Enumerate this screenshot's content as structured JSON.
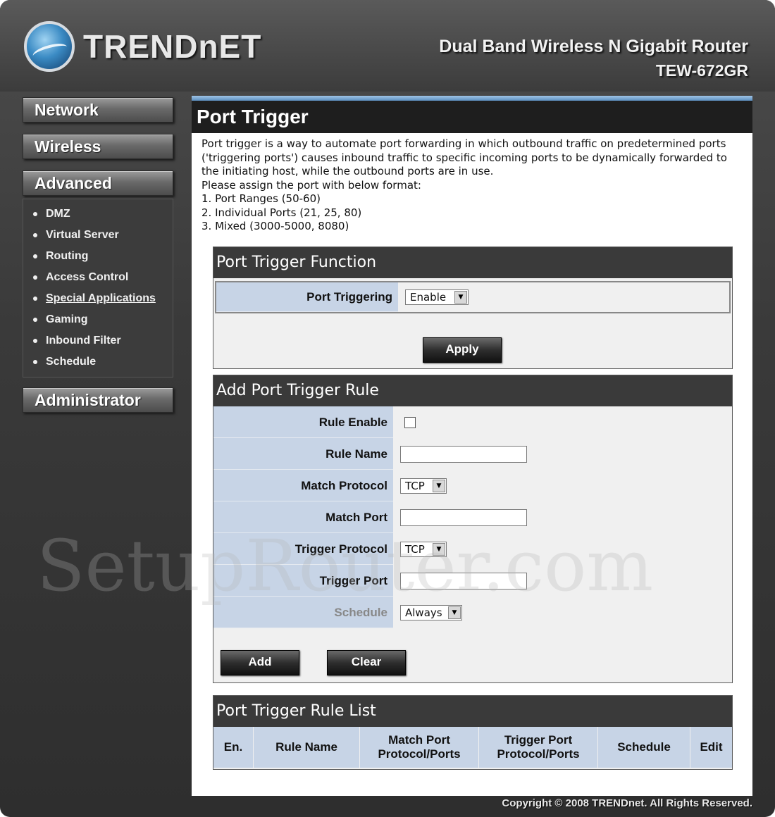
{
  "brand": {
    "logo_text": "TRENDnET",
    "product_line": "Dual Band Wireless N Gigabit Router",
    "model": "TEW-672GR"
  },
  "sidebar": {
    "network": "Network",
    "wireless": "Wireless",
    "advanced": "Advanced",
    "advanced_items": [
      {
        "label": "DMZ"
      },
      {
        "label": "Virtual Server"
      },
      {
        "label": "Routing"
      },
      {
        "label": "Access Control"
      },
      {
        "label": "Special Applications"
      },
      {
        "label": "Gaming"
      },
      {
        "label": "Inbound Filter"
      },
      {
        "label": "Schedule"
      }
    ],
    "administrator": "Administrator"
  },
  "page": {
    "title": "Port Trigger",
    "intro": [
      "Port trigger is a way to automate port forwarding in which outbound traffic on predetermined ports ('triggering ports') causes inbound traffic to specific incoming ports to be dynamically forwarded to the initiating host, while the outbound ports are in use.",
      "Please assign the port with below format:",
      "1. Port Ranges (50-60)",
      "2. Individual Ports (21, 25, 80)",
      "3. Mixed (3000-5000, 8080)"
    ]
  },
  "function_section": {
    "title": "Port Trigger Function",
    "port_triggering_label": "Port Triggering",
    "port_triggering_value": "Enable",
    "apply_label": "Apply"
  },
  "rule_section": {
    "title": "Add Port Trigger Rule",
    "rule_enable_label": "Rule Enable",
    "rule_name_label": "Rule Name",
    "match_protocol_label": "Match Protocol",
    "match_protocol_value": "TCP",
    "match_port_label": "Match Port",
    "trigger_protocol_label": "Trigger Protocol",
    "trigger_protocol_value": "TCP",
    "trigger_port_label": "Trigger Port",
    "schedule_label": "Schedule",
    "schedule_value": "Always",
    "add_label": "Add",
    "clear_label": "Clear"
  },
  "list_section": {
    "title": "Port Trigger Rule List",
    "columns": [
      "En.",
      "Rule Name",
      "Match Port\nProtocol/Ports",
      "Trigger Port\nProtocol/Ports",
      "Schedule",
      "Edit"
    ]
  },
  "watermark": "SetupRouter.com",
  "copyright": "Copyright © 2008 TRENDnet. All Rights Reserved."
}
